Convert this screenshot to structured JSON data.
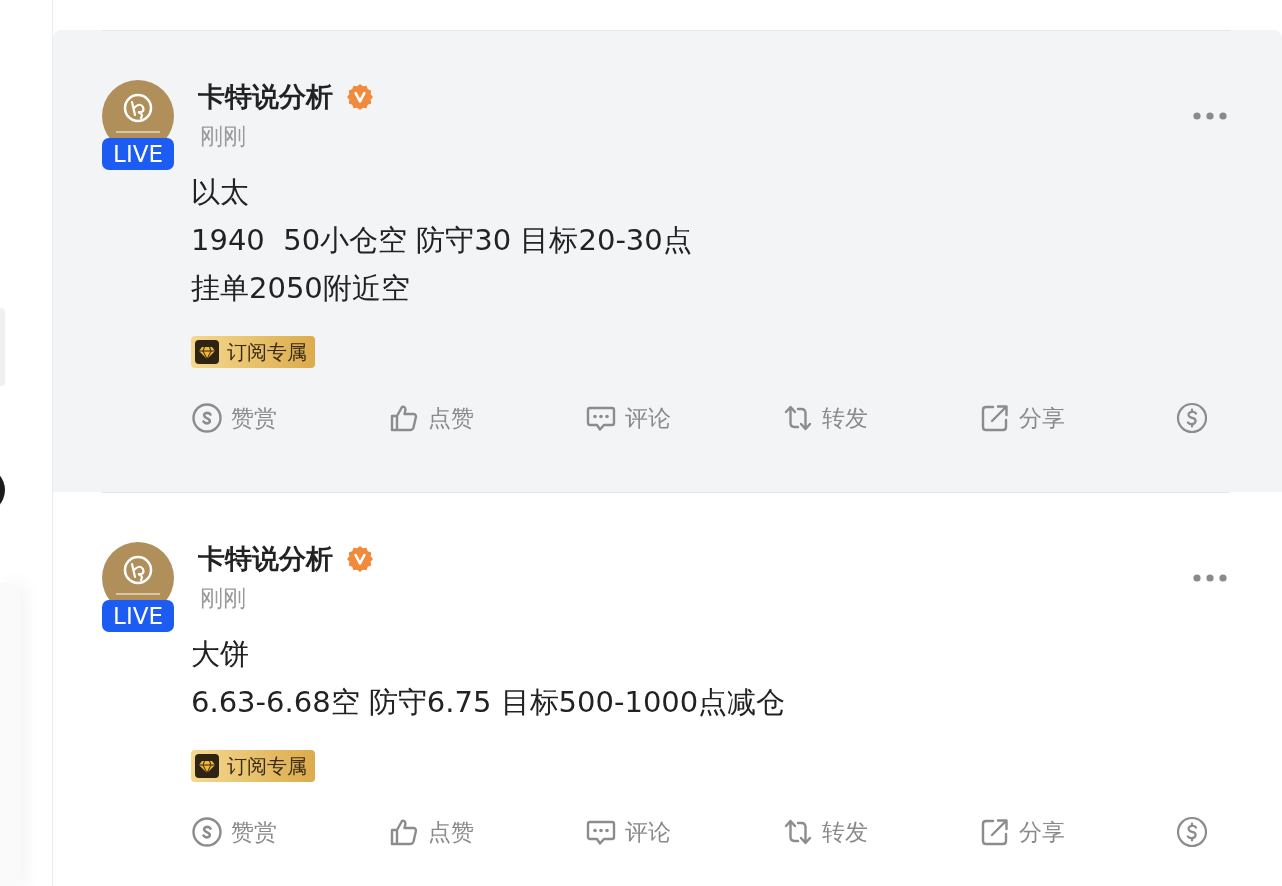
{
  "posts": [
    {
      "hovered": true,
      "author": "卡特说分析",
      "verified": true,
      "live_badge": "LIVE",
      "time": "刚刚",
      "lines": [
        "以太",
        "1940  50小仓空 防守30 目标20-30点",
        "挂单2050附近空"
      ],
      "tag": "订阅专属",
      "actions": [
        {
          "kind": "reward",
          "label": "赞赏"
        },
        {
          "kind": "like",
          "label": "点赞"
        },
        {
          "kind": "comment",
          "label": "评论"
        },
        {
          "kind": "repost",
          "label": "转发"
        },
        {
          "kind": "share",
          "label": "分享"
        },
        {
          "kind": "tip"
        }
      ]
    },
    {
      "hovered": false,
      "author": "卡特说分析",
      "verified": true,
      "live_badge": "LIVE",
      "time": "刚刚",
      "lines": [
        "大饼",
        "6.63-6.68空 防守6.75 目标500-1000点减仓"
      ],
      "tag": "订阅专属",
      "actions": [
        {
          "kind": "reward",
          "label": "赞赏"
        },
        {
          "kind": "like",
          "label": "点赞"
        },
        {
          "kind": "comment",
          "label": "评论"
        },
        {
          "kind": "repost",
          "label": "转发"
        },
        {
          "kind": "share",
          "label": "分享"
        },
        {
          "kind": "tip"
        }
      ]
    }
  ]
}
